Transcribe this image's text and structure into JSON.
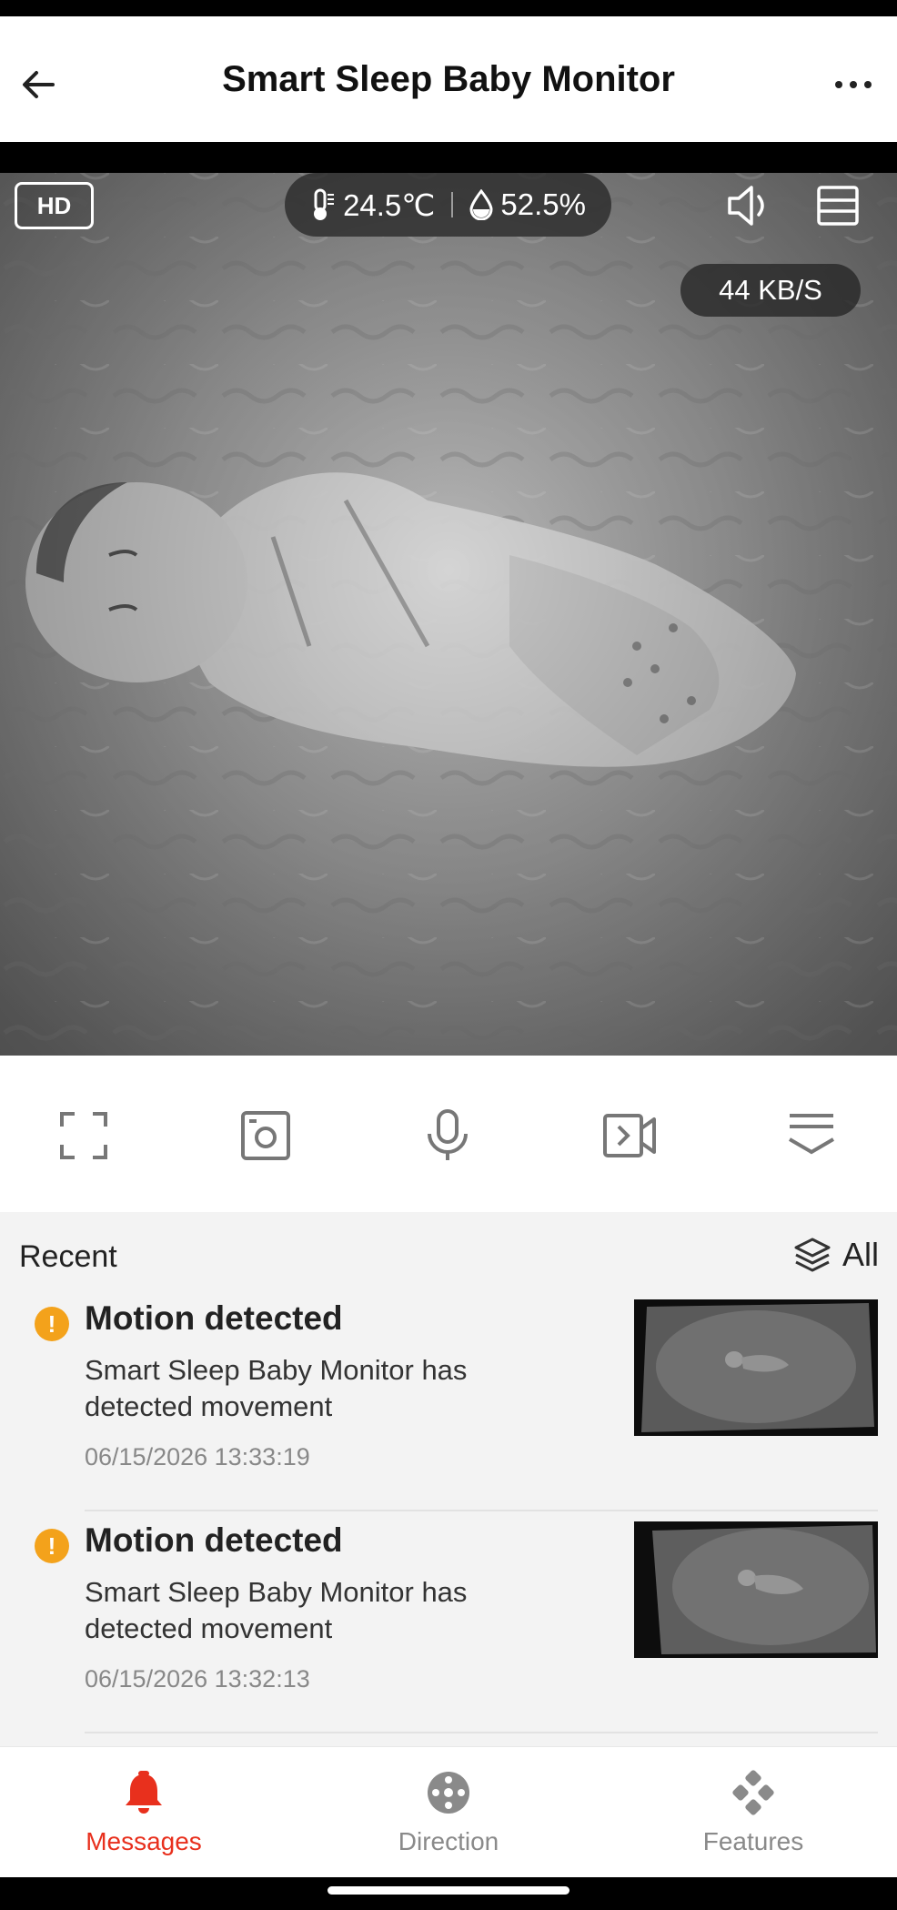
{
  "header": {
    "title": "Smart Sleep Baby Monitor",
    "back_icon": "arrow-left-icon",
    "more_icon": "more-horizontal-icon"
  },
  "video": {
    "quality_badge": "HD",
    "temperature": "24.5℃",
    "humidity": "52.5%",
    "bitrate": "44 KB/S",
    "speaker_icon": "speaker-icon",
    "layout_icon": "layout-icon"
  },
  "controls": {
    "items": [
      {
        "name": "fullscreen",
        "icon": "fullscreen-icon"
      },
      {
        "name": "screenshot",
        "icon": "camera-snapshot-icon"
      },
      {
        "name": "talk",
        "icon": "microphone-icon"
      },
      {
        "name": "record",
        "icon": "video-record-icon"
      },
      {
        "name": "more",
        "icon": "collapse-menu-icon"
      }
    ]
  },
  "events": {
    "heading": "Recent",
    "filter_label": "All",
    "items": [
      {
        "title": "Motion detected",
        "description": "Smart Sleep Baby Monitor has detected movement",
        "time": "06/15/2026 13:33:19"
      },
      {
        "title": "Motion detected",
        "description": "Smart Sleep Baby Monitor has detected movement",
        "time": "06/15/2026 13:32:13"
      }
    ]
  },
  "tabs": {
    "messages": "Messages",
    "direction": "Direction",
    "features": "Features",
    "active_color": "#e8301d",
    "inactive_color": "#8a8a8a"
  },
  "colors": {
    "accent": "#e8301d",
    "warning": "#f3a21b"
  }
}
